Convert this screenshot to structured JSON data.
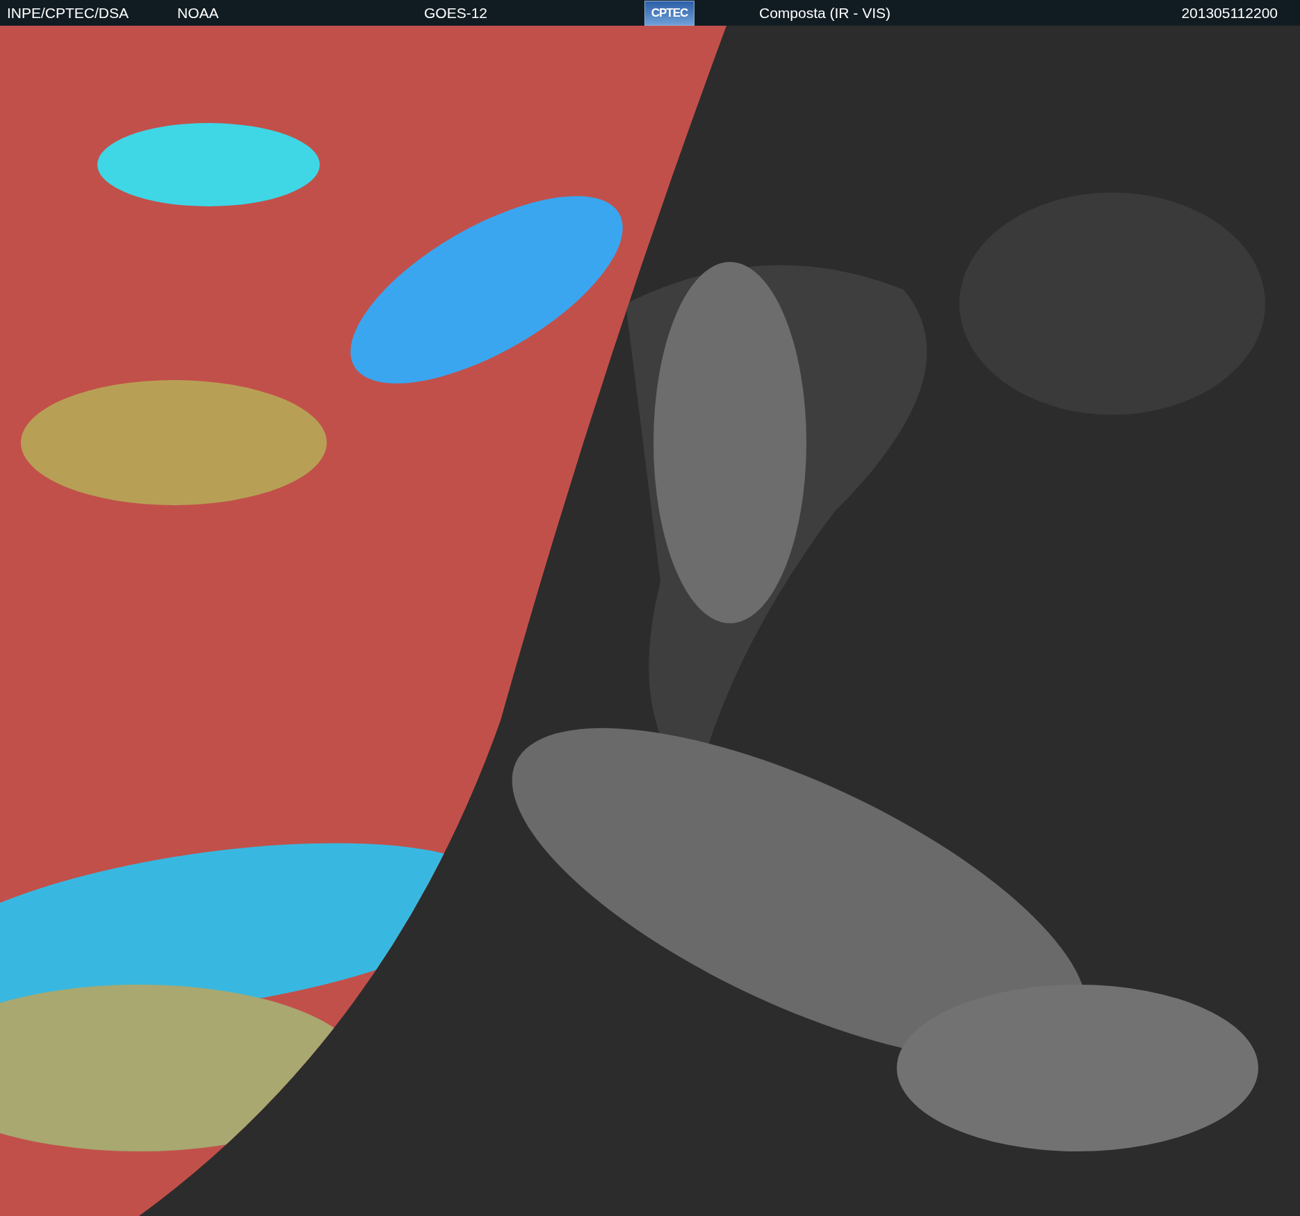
{
  "header": {
    "source": "INPE/CPTEC/DSA",
    "agency": "NOAA",
    "satellite": "GOES-12",
    "logo": "CPTEC",
    "product": "Composta (IR - VIS)",
    "timestamp": "201305112200"
  }
}
